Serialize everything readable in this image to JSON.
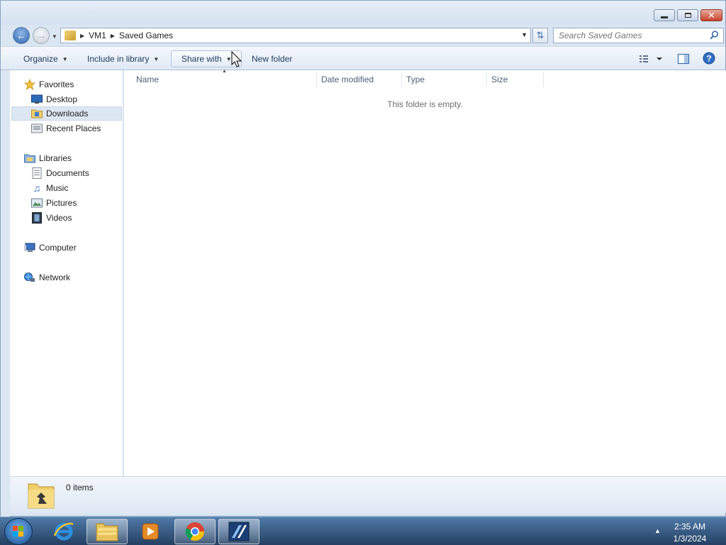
{
  "window": {
    "controls": {
      "minimize": "minimize",
      "maximize": "maximize",
      "close": "close"
    }
  },
  "address": {
    "breadcrumbs": [
      "VM1",
      "Saved Games"
    ],
    "search_placeholder": "Search Saved Games"
  },
  "toolbar": {
    "organize": "Organize",
    "include_in_library": "Include in library",
    "share_with": "Share with",
    "new_folder": "New folder"
  },
  "nav": {
    "favorites": {
      "label": "Favorites",
      "items": [
        "Desktop",
        "Downloads",
        "Recent Places"
      ]
    },
    "libraries": {
      "label": "Libraries",
      "items": [
        "Documents",
        "Music",
        "Pictures",
        "Videos"
      ]
    },
    "computer": "Computer",
    "network": "Network",
    "selected": "Downloads"
  },
  "columns": [
    "Name",
    "Date modified",
    "Type",
    "Size"
  ],
  "empty_message": "This folder is empty.",
  "details": {
    "item_count": "0 items"
  },
  "taskbar": {
    "apps": [
      "internet-explorer",
      "windows-explorer",
      "media-player",
      "google-chrome",
      "app"
    ],
    "clock_time": "2:35 AM",
    "clock_date": "1/3/2024"
  },
  "colors": {
    "accent": "#2e63b0",
    "window_frame": "#dbe6f3",
    "taskbar": "#243f62"
  }
}
